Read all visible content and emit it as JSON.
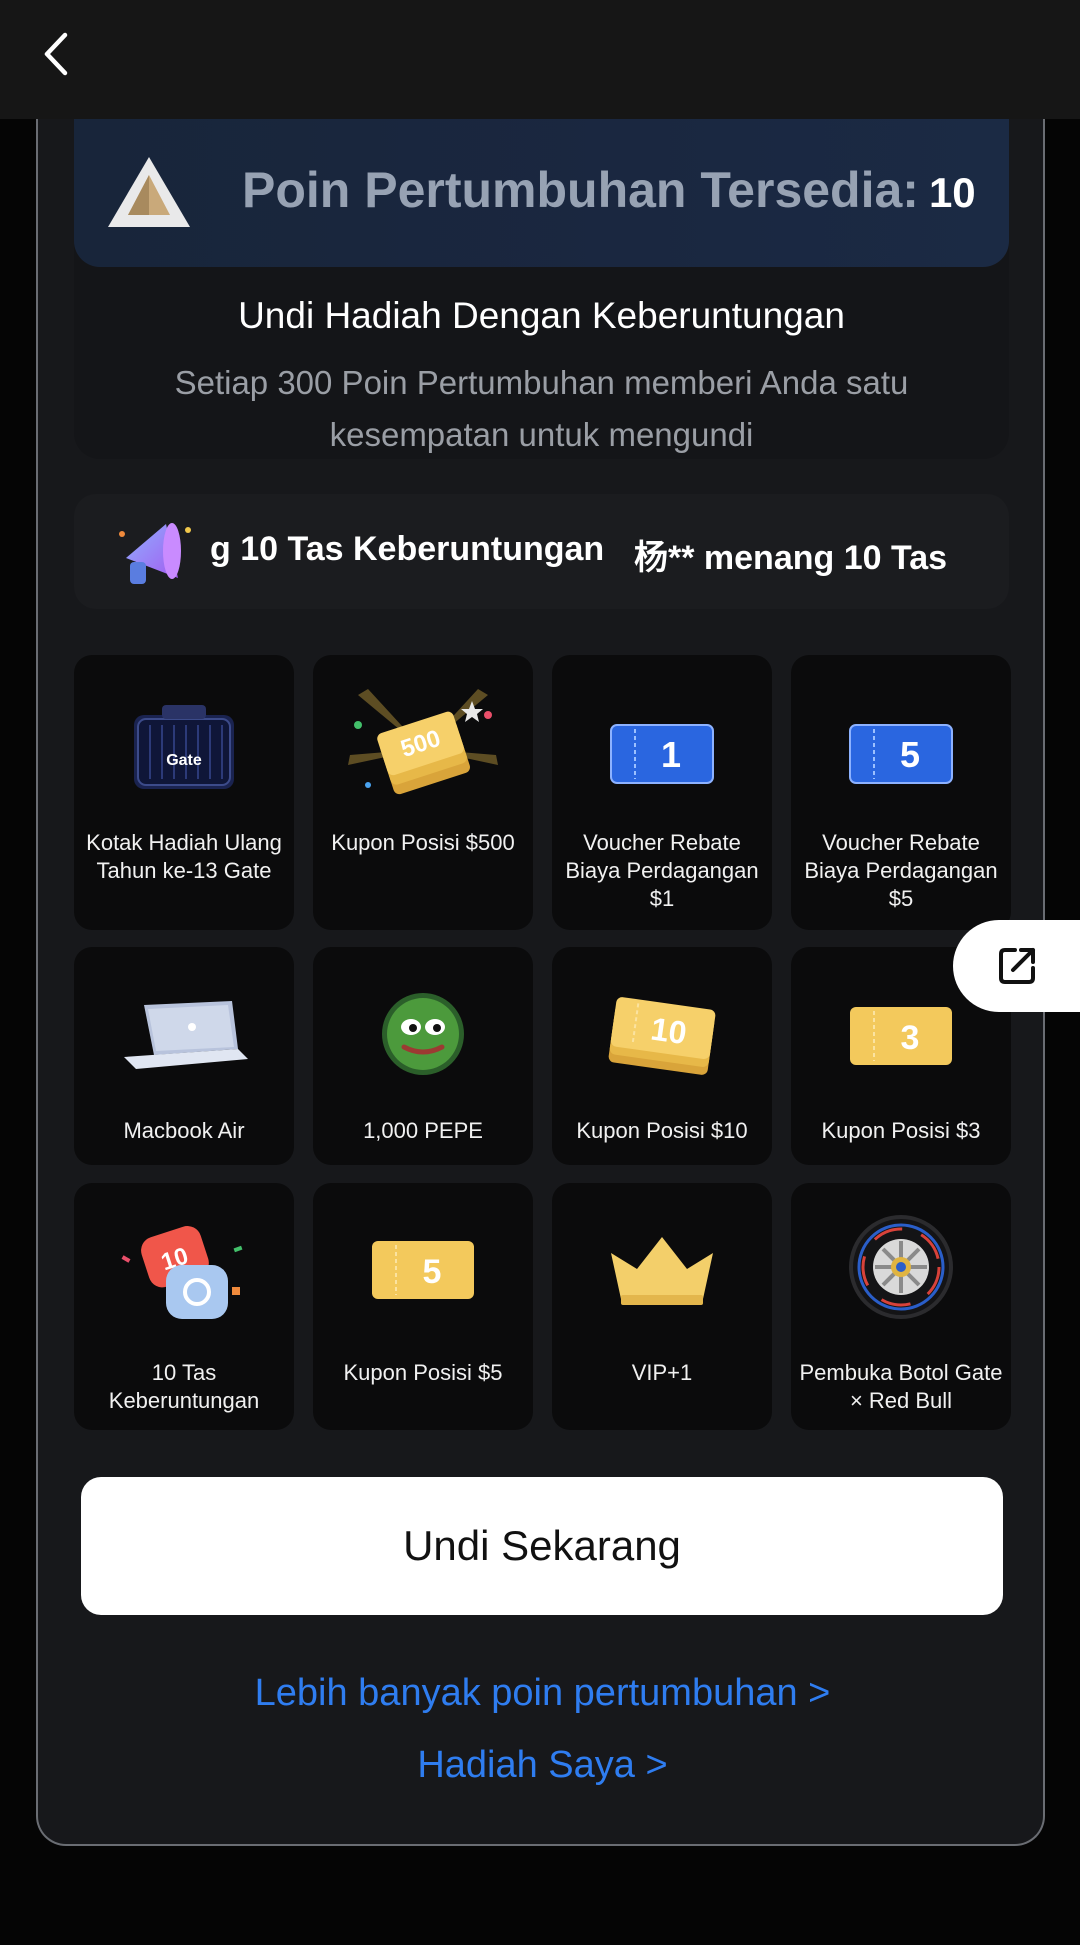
{
  "header": {
    "back_icon": "chevron-left-icon"
  },
  "points": {
    "label": "Poin Pertumbuhan Tersedia:",
    "value": "10",
    "icon": "pyramid-icon"
  },
  "draw_info": {
    "title": "Undi Hadiah Dengan Keberuntungan",
    "subtitle_line1": "Setiap 300 Poin Pertumbuhan memberi Anda satu",
    "subtitle_line2": "kesempatan untuk mengundi"
  },
  "ticker": {
    "icon": "megaphone-icon",
    "items": [
      "g 10 Tas Keberuntungan",
      "杨** menang 10 Tas"
    ]
  },
  "prizes": [
    {
      "icon": "gate-gift-box-icon",
      "label": "Kotak Hadiah Ulang Tahun ke-13 Gate"
    },
    {
      "icon": "coupon-500-icon",
      "label": "Kupon Posisi $500",
      "badge": "500"
    },
    {
      "icon": "voucher-1-icon",
      "label": "Voucher Rebate Biaya Perdagangan $1",
      "badge": "1"
    },
    {
      "icon": "voucher-5-icon",
      "label": "Voucher Rebate Biaya Perdagangan $5",
      "badge": "5"
    },
    {
      "icon": "macbook-icon",
      "label": "Macbook Air"
    },
    {
      "icon": "pepe-icon",
      "label": "1,000 PEPE"
    },
    {
      "icon": "coupon-10-icon",
      "label": "Kupon Posisi $10",
      "badge": "10"
    },
    {
      "icon": "coupon-3-icon",
      "label": "Kupon Posisi $3",
      "badge": "3"
    },
    {
      "icon": "lucky-bag-icon",
      "label": "10 Tas Keberuntungan",
      "badge": "10"
    },
    {
      "icon": "coupon-5-icon",
      "label": "Kupon Posisi $5",
      "badge": "5"
    },
    {
      "icon": "crown-icon",
      "label": "VIP+1"
    },
    {
      "icon": "tire-icon",
      "label": "Pembuka Botol Gate × Red Bull"
    }
  ],
  "actions": {
    "draw_now": "Undi Sekarang",
    "more_points": "Lebih banyak poin pertumbuhan  >",
    "my_prizes": "Hadiah Saya  >",
    "share_icon": "share-external-icon"
  },
  "colors": {
    "link": "#2f7df0",
    "background": "#17181b",
    "banner": "#1a2740"
  }
}
